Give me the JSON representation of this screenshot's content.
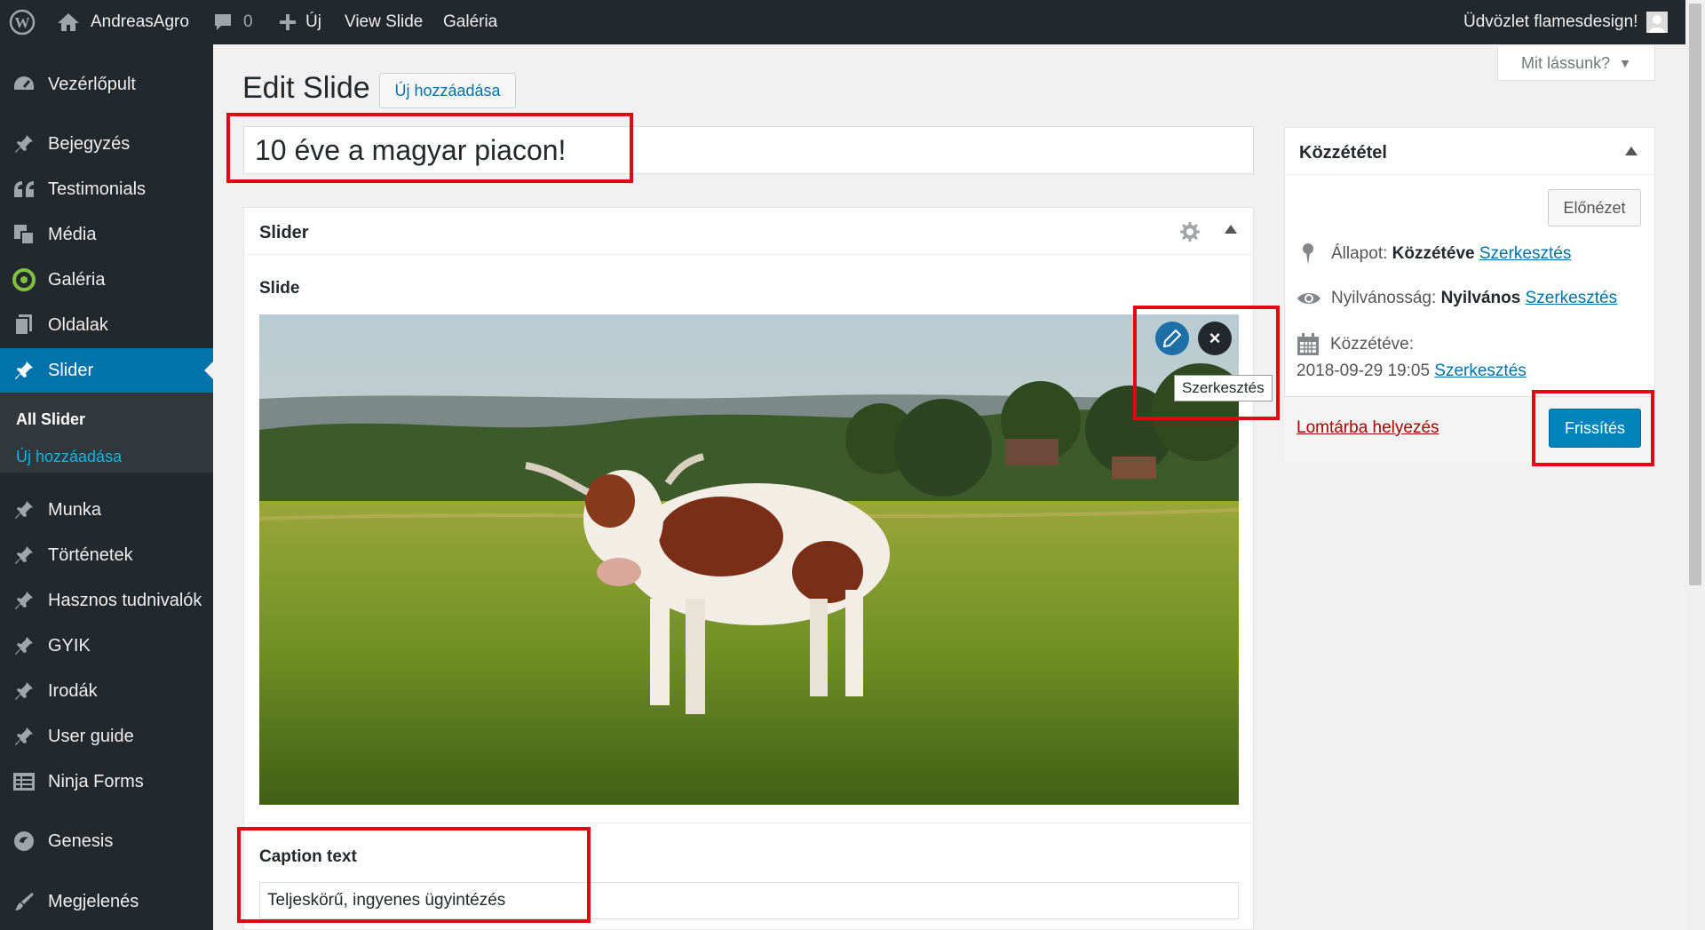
{
  "adminbar": {
    "site_name": "AndreasAgro",
    "comments_count": "0",
    "new_label": "Új",
    "view_label": "View Slide",
    "gallery_label": "Galéria",
    "greeting": "Üdvözlet flamesdesign!"
  },
  "sidebar": {
    "items": [
      {
        "label": "Vezérlőpult",
        "icon": "dashboard-icon"
      },
      {
        "label": "Bejegyzés",
        "icon": "pin-icon"
      },
      {
        "label": "Testimonials",
        "icon": "quote-icon"
      },
      {
        "label": "Média",
        "icon": "media-icon"
      },
      {
        "label": "Galéria",
        "icon": "gallery-icon"
      },
      {
        "label": "Oldalak",
        "icon": "pages-icon"
      },
      {
        "label": "Slider",
        "icon": "pin-icon"
      },
      {
        "label": "Munka",
        "icon": "pin-icon"
      },
      {
        "label": "Történetek",
        "icon": "pin-icon"
      },
      {
        "label": "Hasznos tudnivalók",
        "icon": "pin-icon"
      },
      {
        "label": "GYIK",
        "icon": "pin-icon"
      },
      {
        "label": "Irodák",
        "icon": "pin-icon"
      },
      {
        "label": "User guide",
        "icon": "pin-icon"
      },
      {
        "label": "Ninja Forms",
        "icon": "forms-icon"
      },
      {
        "label": "Genesis",
        "icon": "genesis-icon"
      },
      {
        "label": "Megjelenés",
        "icon": "brush-icon"
      }
    ],
    "submenu": {
      "all": "All Slider",
      "add": "Új hozzáadása"
    }
  },
  "screen_options": "Mit lássunk?",
  "page": {
    "title": "Edit Slide",
    "add_new": "Új hozzáadása",
    "post_title": "10 éve a magyar piacon!"
  },
  "slider_box": {
    "heading": "Slider",
    "slide_label": "Slide",
    "edit_tooltip": "Szerkesztés",
    "caption_label": "Caption text",
    "caption_value": "Teljeskörű, ingyenes ügyintézés"
  },
  "publish_box": {
    "heading": "Közzététel",
    "preview": "Előnézet",
    "status_label": "Állapot:",
    "status_value": "Közzétéve",
    "visibility_label": "Nyilvánosság:",
    "visibility_value": "Nyilvános",
    "published_label": "Közzétéve:",
    "published_date": "2018-09-29 19:05",
    "edit_link": "Szerkesztés",
    "trash": "Lomtárba helyezés",
    "update": "Frissítés"
  },
  "colors": {
    "adminbar_bg": "#23282d",
    "accent": "#0073aa",
    "highlight": "#e30613",
    "trash": "#a00"
  }
}
